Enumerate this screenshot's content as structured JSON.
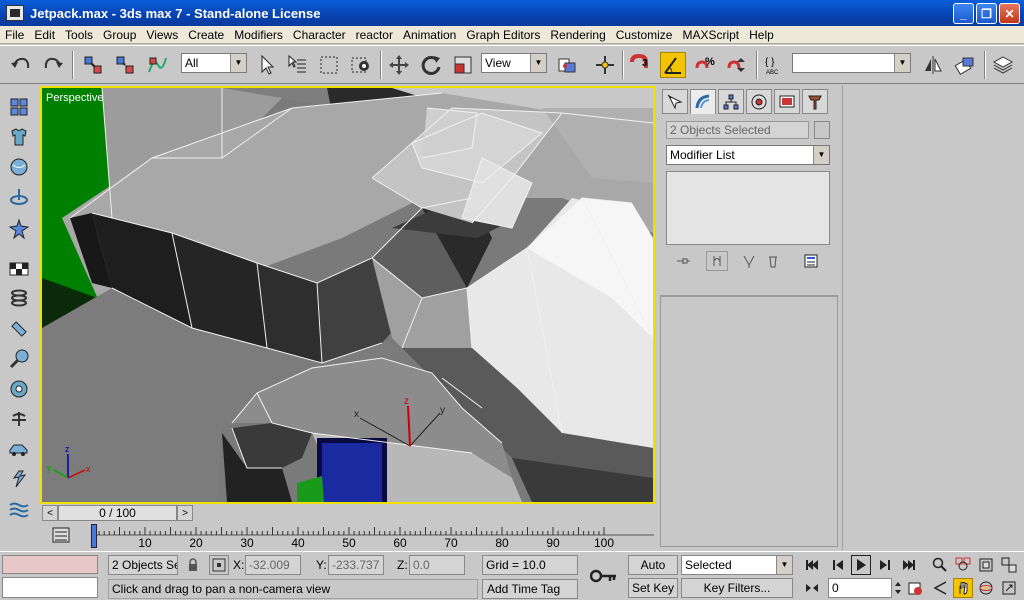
{
  "window": {
    "title": "Jetpack.max - 3ds max 7  - Stand-alone License"
  },
  "menu": [
    "File",
    "Edit",
    "Tools",
    "Group",
    "Views",
    "Create",
    "Modifiers",
    "Character",
    "reactor",
    "Animation",
    "Graph Editors",
    "Rendering",
    "Customize",
    "MAXScript",
    "Help"
  ],
  "toolbar": {
    "selection_filter": "All",
    "reference_coord": "View",
    "named_selection": ""
  },
  "viewport": {
    "label": "Perspective"
  },
  "command_panel": {
    "object_name": "2 Objects Selected",
    "modifier_list": "Modifier List"
  },
  "time_slider": {
    "label": "0 / 100"
  },
  "track_bar": {
    "ticks": [
      "10",
      "20",
      "30",
      "40",
      "50",
      "60",
      "70",
      "80",
      "90",
      "100"
    ]
  },
  "status": {
    "selection": "2 Objects Sel",
    "x_label": "X:",
    "x": "-32.009",
    "y_label": "Y:",
    "y": "-233.737",
    "z_label": "Z:",
    "z": "0.0",
    "grid": "Grid = 10.0",
    "prompt": "Click and drag to pan a non-camera view",
    "add_time_tag": "Add Time Tag",
    "auto_key": "Auto Key",
    "set_key": "Set Key",
    "key_mode": "Selected",
    "key_filters": "Key Filters...",
    "frame": "0"
  },
  "colors": {
    "viewport_border": "#f0e000",
    "green_plane": "#008000",
    "active_button": "#f4c400"
  }
}
